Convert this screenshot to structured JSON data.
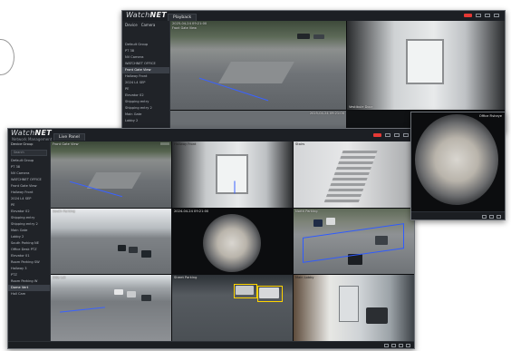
{
  "brand": {
    "name_part1": "Watch",
    "name_part2": "NET",
    "subtitle": "Network Management"
  },
  "back_window": {
    "tab": "Playback",
    "sidebar_head": [
      "Device",
      "Camera"
    ],
    "sidebar_items": [
      "Default Group",
      "PT 38",
      "NV Camera",
      "WATCHNET OFFICE",
      "Front Gate View",
      "Hallway Front",
      "2024 L4 SEP",
      "PE",
      "Elevator 02",
      "Shipping entry",
      "Shipping entry 2",
      "Main Gate",
      "Lobby 2"
    ],
    "cams": [
      {
        "label": "2025-04-24 09:21:00",
        "label2": "Front Gate View"
      },
      {
        "label": "Vestibule Door"
      },
      {
        "label": "2025-04-24 09:21:00"
      }
    ]
  },
  "front_window": {
    "tab": "Live Panel",
    "sidebar_label": "Device Group",
    "search_placeholder": "Search",
    "sidebar_items": [
      "Default Group",
      "PT 38",
      "NV Camera",
      "WATCHNET OFFICE",
      "Front Gate View",
      "Hallway Front",
      "2024 L4 SEP",
      "PE",
      "Elevator 02",
      "Shipping entry",
      "Shipping entry 2",
      "Main Gate",
      "Lobby 2",
      "South Parking NE",
      "Office Desk PTZ",
      "Elevator 01",
      "Room Parking SW",
      "Hallway 3",
      "PTZ",
      "Room Parking W",
      "Dome Vert",
      "Hall Cam"
    ],
    "cams": [
      {
        "label": "Front Gate View"
      },
      {
        "label": "Hallway Front"
      },
      {
        "label": "Stairs"
      },
      {
        "label": "Office Fisheye"
      },
      {
        "label": "South Parking"
      },
      {
        "label": "2024-04-24 09:21:00"
      },
      {
        "label": "North Parking"
      },
      {
        "label": "Side Lot"
      },
      {
        "label": "Street Parking"
      },
      {
        "label": "Main Lobby"
      }
    ]
  },
  "colors": {
    "accent_red": "#e53935",
    "analytic_blue": "#2f5bff",
    "analytic_yellow": "#ffd400"
  }
}
